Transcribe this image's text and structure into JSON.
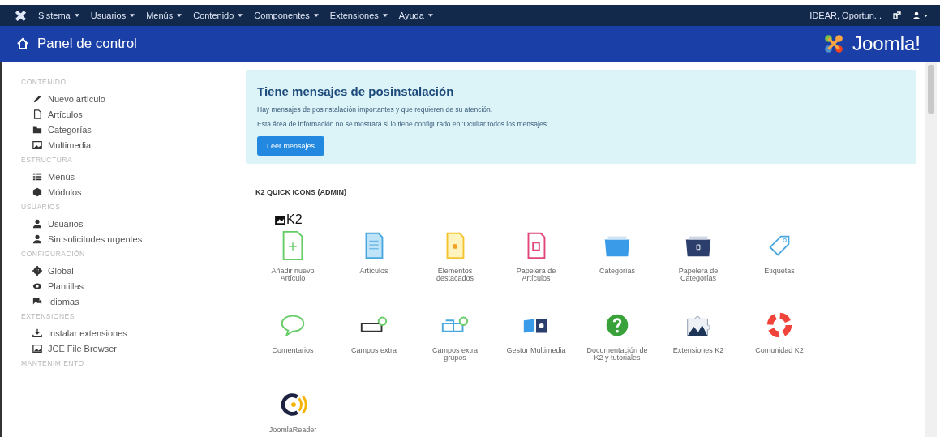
{
  "topbar": {
    "menus": [
      "Sistema",
      "Usuarios",
      "Menús",
      "Contenido",
      "Componentes",
      "Extensiones",
      "Ayuda"
    ],
    "site": "IDEAR, Oportun..."
  },
  "header": {
    "title": "Panel de control",
    "brand": "Joomla!"
  },
  "sidebar": [
    {
      "heading": "CONTENIDO",
      "items": [
        {
          "label": "Nuevo artículo",
          "kind": "pencil"
        },
        {
          "label": "Artículos",
          "kind": "file"
        },
        {
          "label": "Categorías",
          "kind": "folder"
        },
        {
          "label": "Multimedia",
          "kind": "image"
        }
      ]
    },
    {
      "heading": "ESTRUCTURA",
      "items": [
        {
          "label": "Menús",
          "kind": "list"
        },
        {
          "label": "Módulos",
          "kind": "cube"
        }
      ]
    },
    {
      "heading": "USUARIOS",
      "items": [
        {
          "label": "Usuarios",
          "kind": "users"
        },
        {
          "label": "Sin solicitudes urgentes",
          "kind": "users"
        }
      ]
    },
    {
      "heading": "CONFIGURACIÓN",
      "items": [
        {
          "label": "Global",
          "kind": "gear"
        },
        {
          "label": "Plantillas",
          "kind": "eye"
        },
        {
          "label": "Idiomas",
          "kind": "chat"
        }
      ]
    },
    {
      "heading": "EXTENSIONES",
      "items": [
        {
          "label": "Instalar extensiones",
          "kind": "download"
        },
        {
          "label": "JCE File Browser",
          "kind": "image"
        }
      ]
    },
    {
      "heading": "MANTENIMIENTO"
    }
  ],
  "alert": {
    "title": "Tiene mensajes de posinstalación",
    "lines": [
      "Hay mensajes de posinstalación importantes y que requieren de su atención.",
      "Esta área de información no se mostrará si lo tiene configurado en 'Ocultar todos los mensajes'."
    ],
    "button": "Leer mensajes"
  },
  "k2": {
    "heading": "K2 QUICK ICONS (ADMIN)",
    "logo": "K2",
    "icons": [
      {
        "label": "Añadir nuevo Artículo",
        "kind": "newdoc"
      },
      {
        "label": "Artículos",
        "kind": "doc"
      },
      {
        "label": "Elementos destacados",
        "kind": "star"
      },
      {
        "label": "Papelera de Artículos",
        "kind": "trashdoc"
      },
      {
        "label": "Categorías",
        "kind": "folder"
      },
      {
        "label": "Papelera de Categorías",
        "kind": "trashfolder"
      },
      {
        "label": "Etiquetas",
        "kind": "tag"
      },
      {
        "label": "Comentarios",
        "kind": "comment"
      },
      {
        "label": "Campos extra",
        "kind": "field"
      },
      {
        "label": "Campos extra grupos",
        "kind": "fields"
      },
      {
        "label": "Gestor Multimedia",
        "kind": "media"
      },
      {
        "label": "Documentación de K2 y tutoriales",
        "kind": "help"
      },
      {
        "label": "Extensiones K2",
        "kind": "puzzle"
      },
      {
        "label": "Comunidad K2",
        "kind": "lifebuoy"
      },
      {
        "label": "JoomlaReader",
        "kind": "reader"
      }
    ]
  }
}
